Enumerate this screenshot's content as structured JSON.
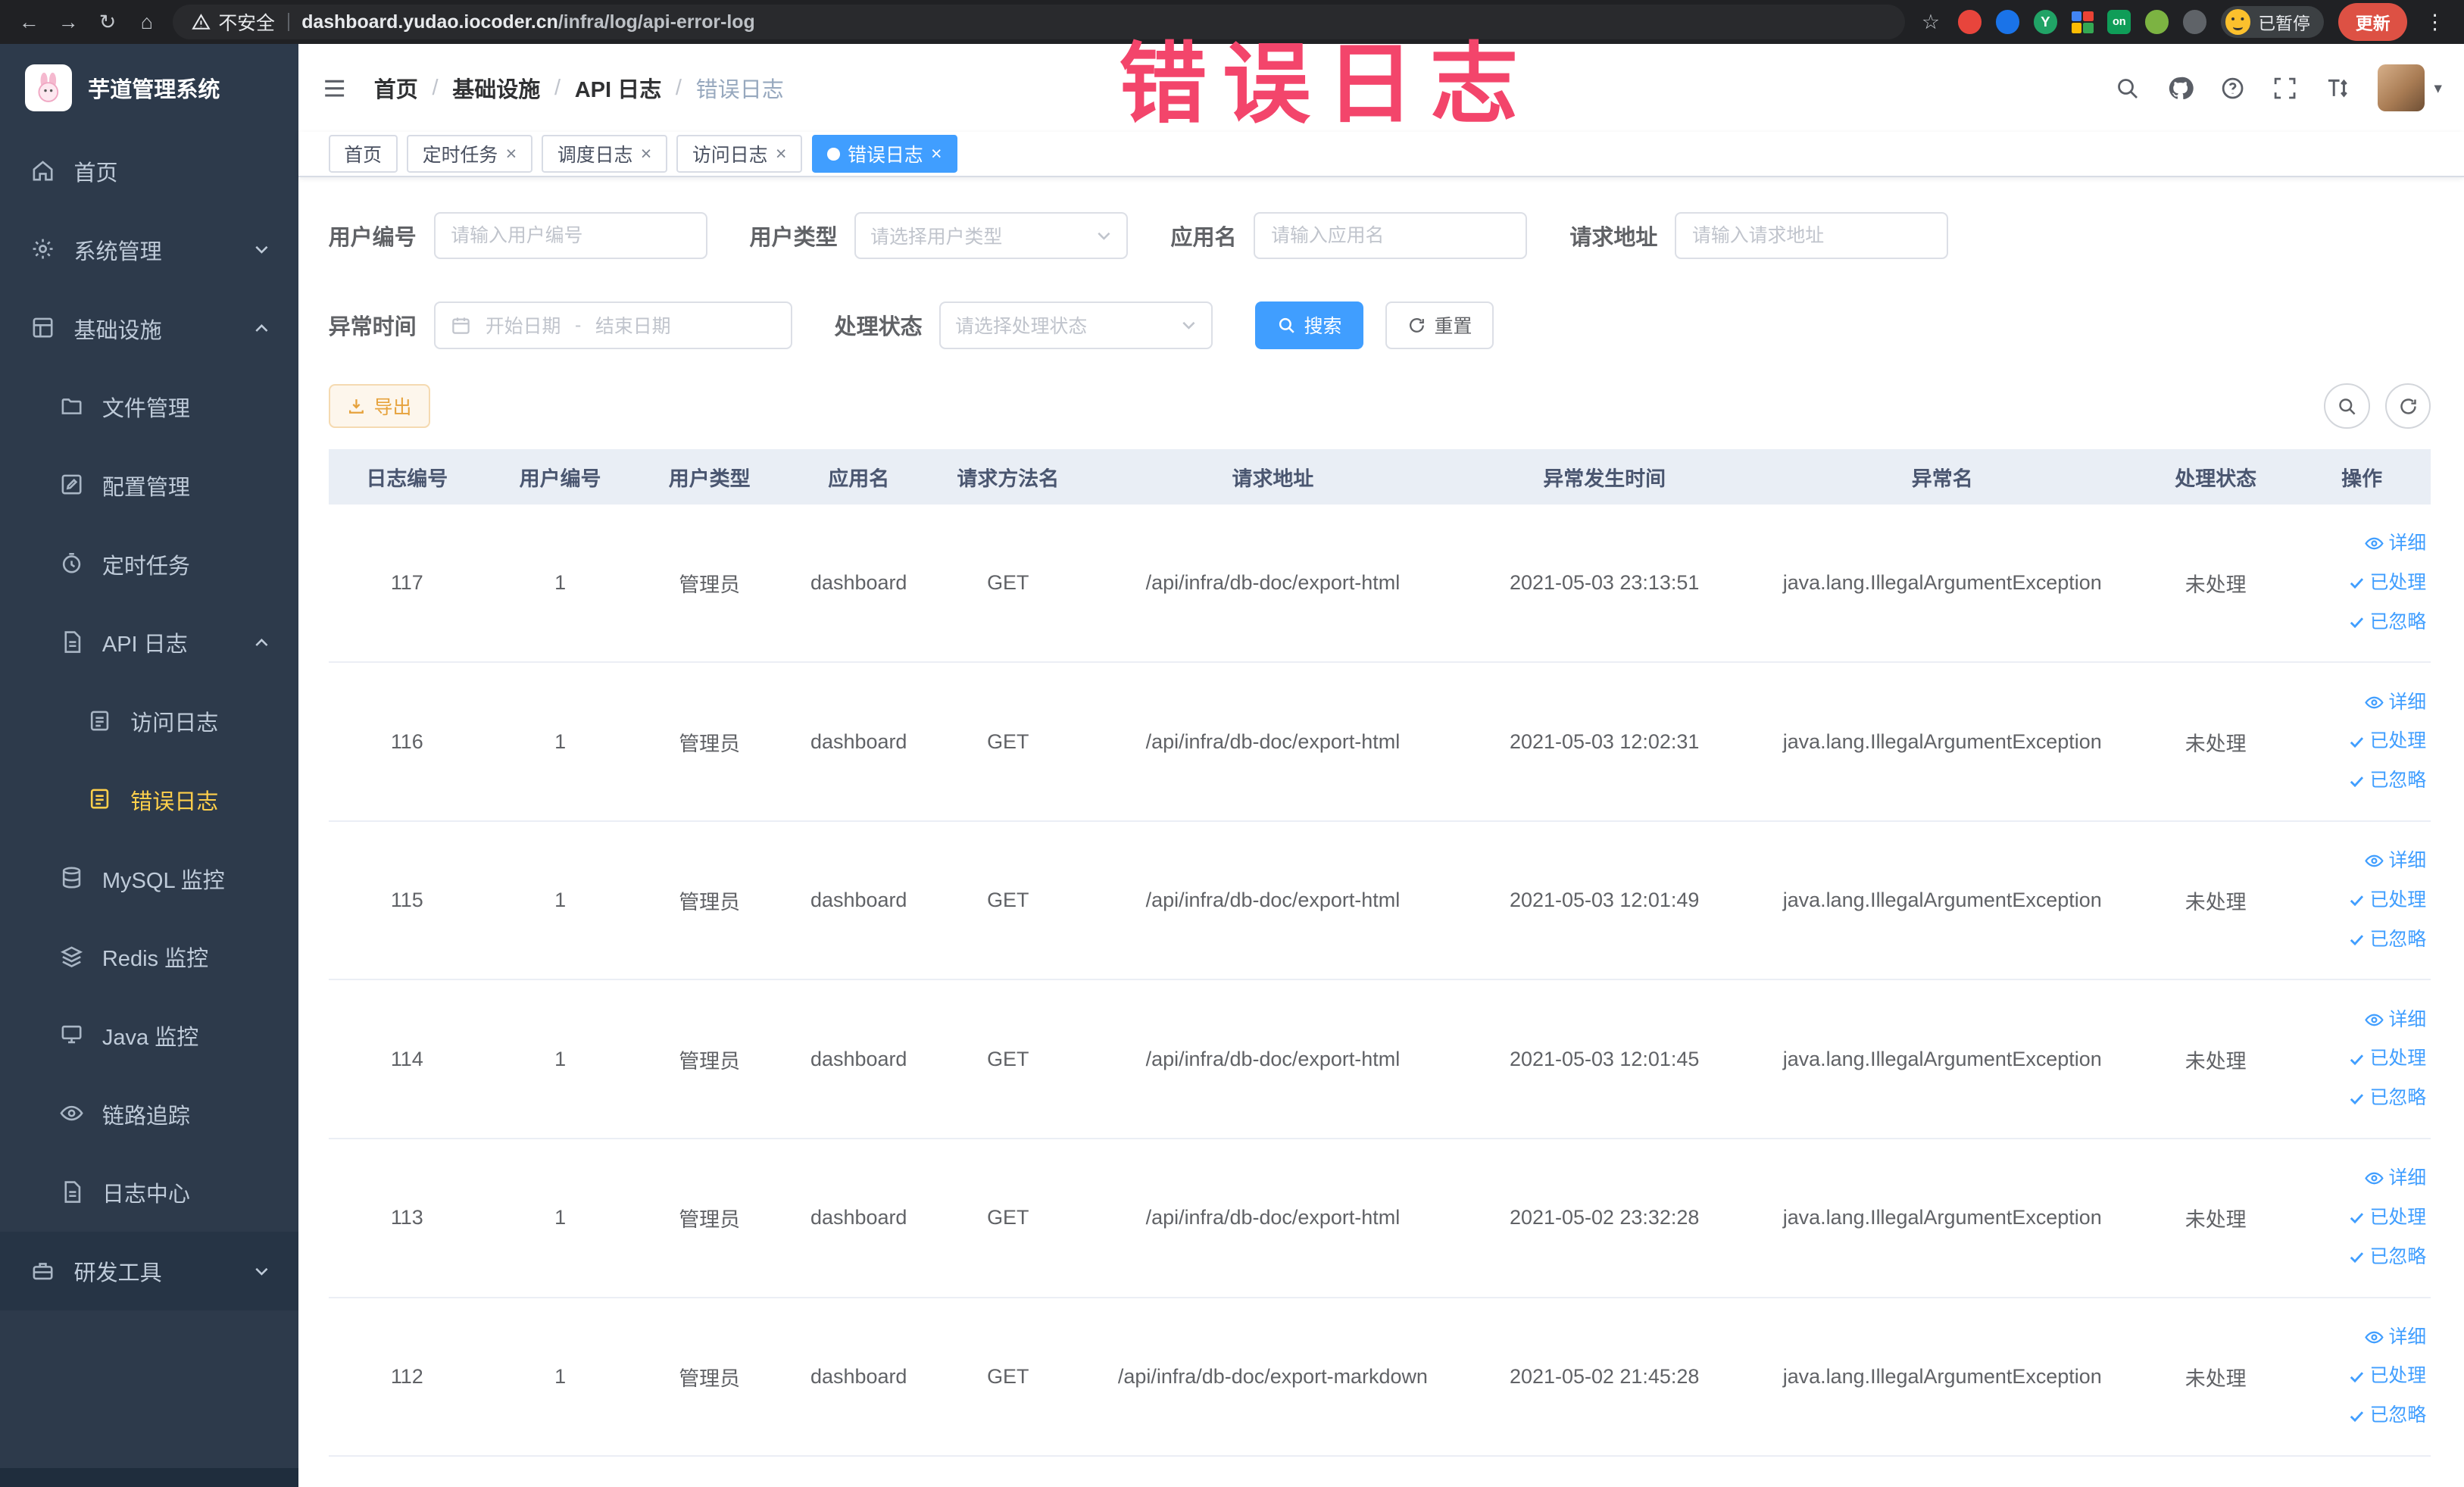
{
  "watermark": "错误日志",
  "browser": {
    "security_label": "不安全",
    "url_domain": "dashboard.yudao.iocoder.cn",
    "url_path": "/infra/log/api-error-log",
    "extension_on_label": "on",
    "paused_badge": "已暂停",
    "update_button": "更新"
  },
  "sidebar": {
    "logo_title": "芋道管理系统",
    "items": [
      {
        "label": "首页"
      },
      {
        "label": "系统管理"
      },
      {
        "label": "基础设施"
      },
      {
        "label": "文件管理"
      },
      {
        "label": "配置管理"
      },
      {
        "label": "定时任务"
      },
      {
        "label": "API 日志"
      },
      {
        "label": "访问日志"
      },
      {
        "label": "错误日志"
      },
      {
        "label": "MySQL 监控"
      },
      {
        "label": "Redis 监控"
      },
      {
        "label": "Java 监控"
      },
      {
        "label": "链路追踪"
      },
      {
        "label": "日志中心"
      },
      {
        "label": "研发工具"
      }
    ]
  },
  "breadcrumb": {
    "items": [
      "首页",
      "基础设施",
      "API 日志",
      "错误日志"
    ],
    "separator": "/"
  },
  "tabs": [
    {
      "label": "首页"
    },
    {
      "label": "定时任务"
    },
    {
      "label": "调度日志"
    },
    {
      "label": "访问日志"
    },
    {
      "label": "错误日志"
    }
  ],
  "filters": {
    "user_id_label": "用户编号",
    "user_id_placeholder": "请输入用户编号",
    "user_type_label": "用户类型",
    "user_type_placeholder": "请选择用户类型",
    "app_name_label": "应用名",
    "app_name_placeholder": "请输入应用名",
    "request_url_label": "请求地址",
    "request_url_placeholder": "请输入请求地址",
    "exception_time_label": "异常时间",
    "date_start_placeholder": "开始日期",
    "date_separator": "-",
    "date_end_placeholder": "结束日期",
    "process_status_label": "处理状态",
    "process_status_placeholder": "请选择处理状态",
    "search_label": "搜索",
    "reset_label": "重置"
  },
  "toolbar": {
    "export_label": "导出"
  },
  "table": {
    "headers": [
      "日志编号",
      "用户编号",
      "用户类型",
      "应用名",
      "请求方法名",
      "请求地址",
      "异常发生时间",
      "异常名",
      "处理状态",
      "操作"
    ],
    "actions": {
      "detail": "详细",
      "processed": "已处理",
      "ignored": "已忽略"
    },
    "rows": [
      {
        "id": "117",
        "user_id": "1",
        "user_type": "管理员",
        "app": "dashboard",
        "method": "GET",
        "url": "/api/infra/db-doc/export-html",
        "time": "2021-05-03 23:13:51",
        "exception": "java.lang.IllegalArgumentException",
        "status": "未处理"
      },
      {
        "id": "116",
        "user_id": "1",
        "user_type": "管理员",
        "app": "dashboard",
        "method": "GET",
        "url": "/api/infra/db-doc/export-html",
        "time": "2021-05-03 12:02:31",
        "exception": "java.lang.IllegalArgumentException",
        "status": "未处理"
      },
      {
        "id": "115",
        "user_id": "1",
        "user_type": "管理员",
        "app": "dashboard",
        "method": "GET",
        "url": "/api/infra/db-doc/export-html",
        "time": "2021-05-03 12:01:49",
        "exception": "java.lang.IllegalArgumentException",
        "status": "未处理"
      },
      {
        "id": "114",
        "user_id": "1",
        "user_type": "管理员",
        "app": "dashboard",
        "method": "GET",
        "url": "/api/infra/db-doc/export-html",
        "time": "2021-05-03 12:01:45",
        "exception": "java.lang.IllegalArgumentException",
        "status": "未处理"
      },
      {
        "id": "113",
        "user_id": "1",
        "user_type": "管理员",
        "app": "dashboard",
        "method": "GET",
        "url": "/api/infra/db-doc/export-html",
        "time": "2021-05-02 23:32:28",
        "exception": "java.lang.IllegalArgumentException",
        "status": "未处理"
      },
      {
        "id": "112",
        "user_id": "1",
        "user_type": "管理员",
        "app": "dashboard",
        "method": "GET",
        "url": "/api/infra/db-doc/export-markdown",
        "time": "2021-05-02 21:45:28",
        "exception": "java.lang.IllegalArgumentException",
        "status": "未处理"
      }
    ]
  },
  "colors": {
    "primary": "#409eff",
    "sidebar_bg": "#2d3a4b",
    "active_menu_text": "#ffd04b",
    "warning": "#e6a23c",
    "watermark_pink": "#f3456b",
    "table_header_bg": "#e9eef5"
  }
}
